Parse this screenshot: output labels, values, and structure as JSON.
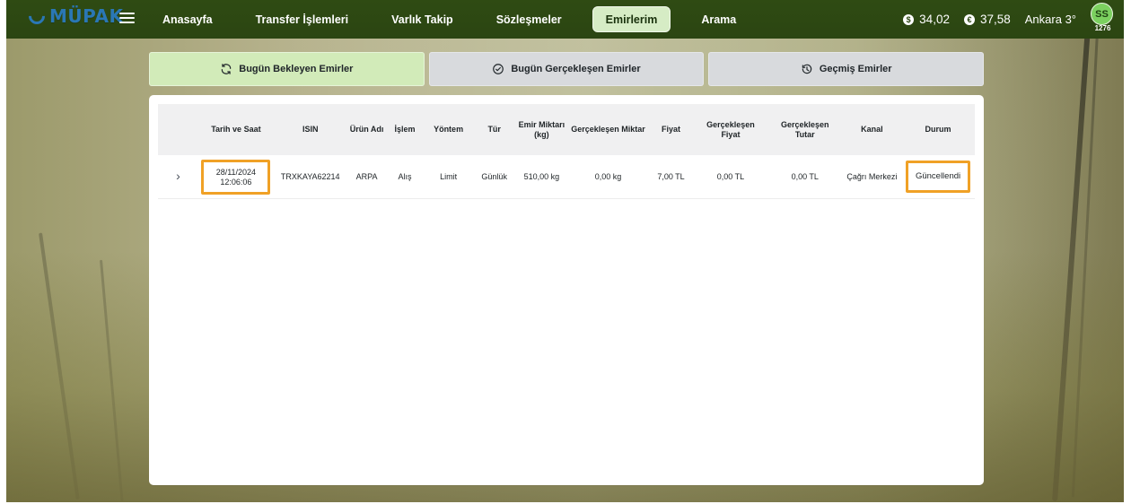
{
  "nav": {
    "brand": "MÜPAK",
    "items": [
      {
        "label": "Anasayfa",
        "active": false
      },
      {
        "label": "Transfer İşlemleri",
        "active": false
      },
      {
        "label": "Varlık Takip",
        "active": false
      },
      {
        "label": "Sözleşmeler",
        "active": false
      },
      {
        "label": "Emirlerim",
        "active": true
      },
      {
        "label": "Arama",
        "active": false
      }
    ],
    "rates": [
      {
        "icon": "dollar-icon",
        "value": "34,02"
      },
      {
        "icon": "euro-icon",
        "value": "37,58"
      }
    ],
    "weather": "Ankara 3°",
    "user": {
      "initials": "SS",
      "number": "1276"
    }
  },
  "tabs": [
    {
      "icon": "refresh-icon",
      "label": "Bugün Bekleyen Emirler",
      "active": true
    },
    {
      "icon": "check-circle-icon",
      "label": "Bugün Gerçekleşen Emirler",
      "active": false
    },
    {
      "icon": "history-icon",
      "label": "Geçmiş Emirler",
      "active": false
    }
  ],
  "table": {
    "headers": [
      "Tarih ve Saat",
      "ISIN",
      "Ürün Adı",
      "İşlem",
      "Yöntem",
      "Tür",
      "Emir Miktarı (kg)",
      "Gerçekleşen Miktar",
      "Fiyat",
      "Gerçekleşen Fiyat",
      "Gerçekleşen Tutar",
      "Kanal",
      "Durum"
    ],
    "rows": [
      {
        "date": "28/11/2024",
        "time": "12:06:06",
        "isin": "TRXKAYA62214",
        "product": "ARPA",
        "operation": "Alış",
        "method": "Limit",
        "type": "Günlük",
        "order_amount": "510,00 kg",
        "realized_amount": "0,00 kg",
        "price": "7,00 TL",
        "realized_price": "0,00 TL",
        "realized_total": "0,00 TL",
        "channel": "Çağrı Merkezi",
        "status": "Güncellendi"
      }
    ]
  },
  "colors": {
    "topbar": "#2b4512",
    "brand_blue": "#2a77b5",
    "active_nav": "#d6ecc5",
    "active_tab": "#d2ebb9",
    "highlight": "#f0a126"
  }
}
